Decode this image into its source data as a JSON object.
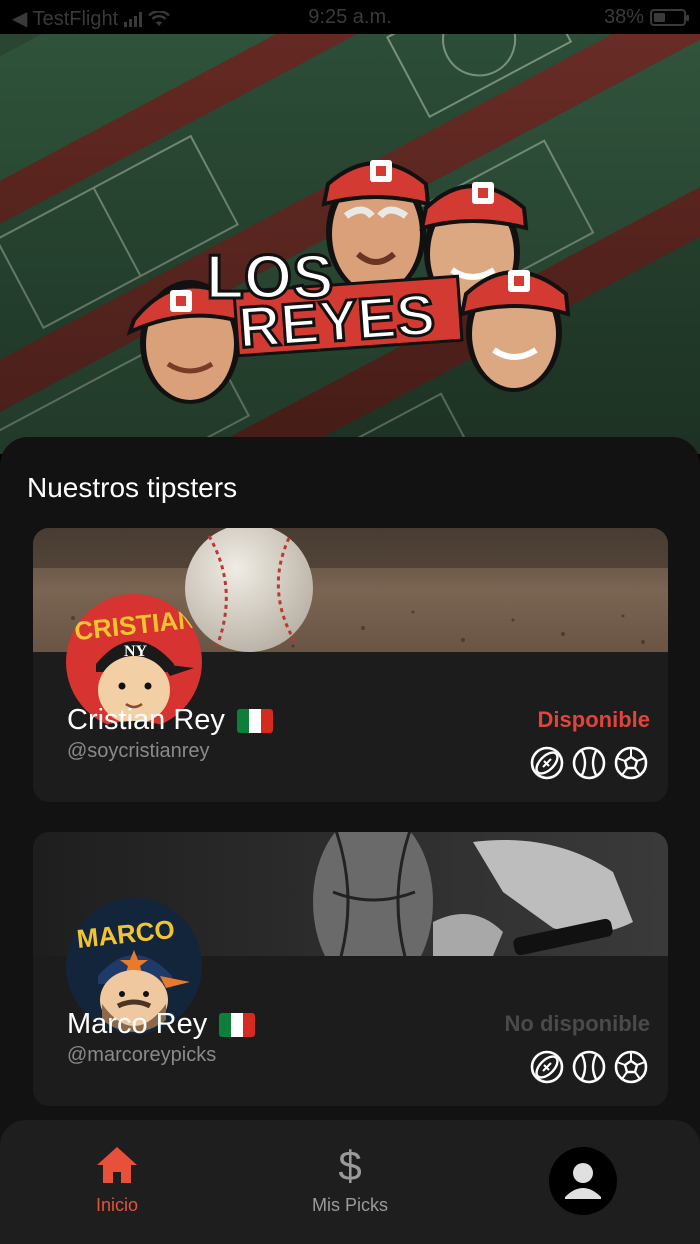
{
  "status_bar": {
    "back_app": "◀ TestFlight",
    "time": "9:25 a.m.",
    "battery": "38%",
    "battery_level": 0.38
  },
  "hero": {
    "logo_line1": "LOS",
    "logo_line2": "REYES"
  },
  "section_title": "Nuestros tipsters",
  "tipsters": [
    {
      "name": "Cristian Rey",
      "handle": "@soycristianrey",
      "status": "Disponible",
      "status_color": "#e0443a",
      "flag": "mexico-flag",
      "sports": [
        "football-icon",
        "baseball-icon",
        "soccer-icon"
      ]
    },
    {
      "name": "Marco Rey",
      "handle": "@marcoreypicks",
      "status": "No disponible",
      "status_color": "#4a4a4a",
      "flag": "mexico-flag",
      "sports": [
        "football-icon",
        "baseball-icon",
        "soccer-icon"
      ]
    }
  ],
  "nav": {
    "home_label": "Inicio",
    "picks_label": "Mis Picks",
    "picks_icon_glyph": "$",
    "active_color": "#e8503a",
    "inactive_color": "#9a9a9a"
  }
}
